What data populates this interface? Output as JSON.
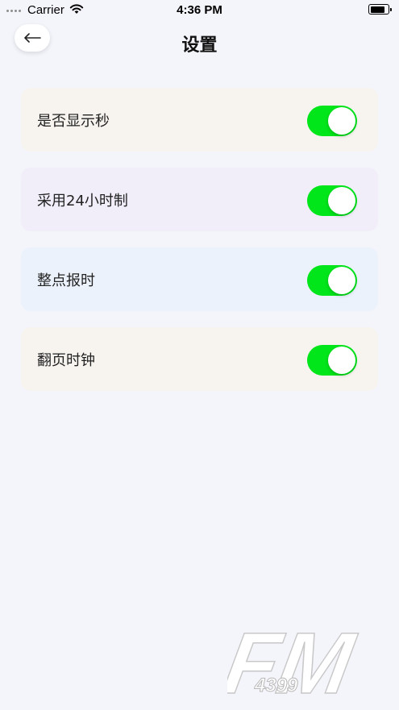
{
  "status_bar": {
    "carrier": "Carrier",
    "time": "4:36 PM"
  },
  "nav": {
    "back_icon": "arrow-left-icon",
    "title": "设置"
  },
  "settings": [
    {
      "label": "是否显示秒",
      "enabled": true,
      "bg_color": "#f7f4f0"
    },
    {
      "label": "采用24小时制",
      "enabled": true,
      "bg_color": "#f1eefa"
    },
    {
      "label": "整点报时",
      "enabled": true,
      "bg_color": "#ecf2fb"
    },
    {
      "label": "翻页时钟",
      "enabled": true,
      "bg_color": "#f7f4f0"
    }
  ],
  "colors": {
    "background": "#f4f4fb",
    "toggle_on": "#00e61a"
  },
  "watermark": {
    "text_large": "FM",
    "text_small": "4399"
  }
}
